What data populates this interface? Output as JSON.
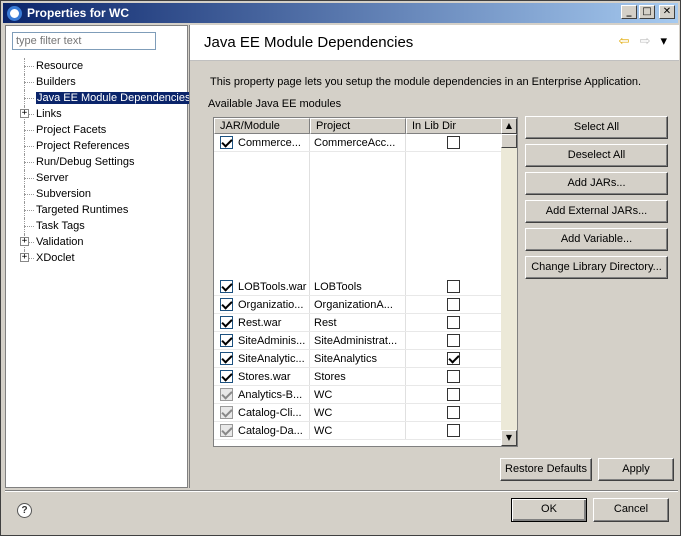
{
  "window": {
    "title": "Properties for WC"
  },
  "filter": {
    "placeholder": "type filter text"
  },
  "tree": [
    {
      "label": "Resource"
    },
    {
      "label": "Builders"
    },
    {
      "label": "Java EE Module Dependencies"
    },
    {
      "label": "Links"
    },
    {
      "label": "Project Facets"
    },
    {
      "label": "Project References"
    },
    {
      "label": "Run/Debug Settings"
    },
    {
      "label": "Server"
    },
    {
      "label": "Subversion"
    },
    {
      "label": "Targeted Runtimes"
    },
    {
      "label": "Task Tags"
    },
    {
      "label": "Validation"
    },
    {
      "label": "XDoclet"
    }
  ],
  "page": {
    "title": "Java EE Module Dependencies",
    "description": "This property page lets you setup the module dependencies in an Enterprise Application.",
    "available_label": "Available Java EE modules"
  },
  "table": {
    "headers": [
      "JAR/Module",
      "Project",
      "In Lib Dir"
    ],
    "rows": [
      {
        "module": "Commerce...",
        "project": "CommerceAcc...",
        "checked": true,
        "lib": false
      },
      {
        "module": "LOBTools.war",
        "project": "LOBTools",
        "checked": true,
        "lib": false
      },
      {
        "module": "Organizatio...",
        "project": "OrganizationA...",
        "checked": true,
        "lib": false
      },
      {
        "module": "Rest.war",
        "project": "Rest",
        "checked": true,
        "lib": false
      },
      {
        "module": "SiteAdminis...",
        "project": "SiteAdministrat...",
        "checked": true,
        "lib": false
      },
      {
        "module": "SiteAnalytic...",
        "project": "SiteAnalytics",
        "checked": true,
        "lib": true
      },
      {
        "module": "Stores.war",
        "project": "Stores",
        "checked": true,
        "lib": false
      },
      {
        "module": "Analytics-B...",
        "project": "WC",
        "checked": true,
        "lib": false
      },
      {
        "module": "Catalog-Cli...",
        "project": "WC",
        "checked": true,
        "lib": false
      },
      {
        "module": "Catalog-Da...",
        "project": "WC",
        "checked": true,
        "lib": false
      }
    ]
  },
  "buttons": {
    "select_all": "Select All",
    "deselect_all": "Deselect All",
    "add_jars": "Add JARs...",
    "add_external_jars": "Add External JARs...",
    "add_variable": "Add Variable...",
    "change_lib_dir": "Change Library Directory...",
    "restore_defaults": "Restore Defaults",
    "apply": "Apply",
    "ok": "OK",
    "cancel": "Cancel"
  },
  "icons": {
    "help": "?",
    "back": "⇦",
    "forward": "⇨",
    "dropdown": "▾",
    "minimize": "_",
    "maximize": "□",
    "close": "✕",
    "expand": "+"
  }
}
